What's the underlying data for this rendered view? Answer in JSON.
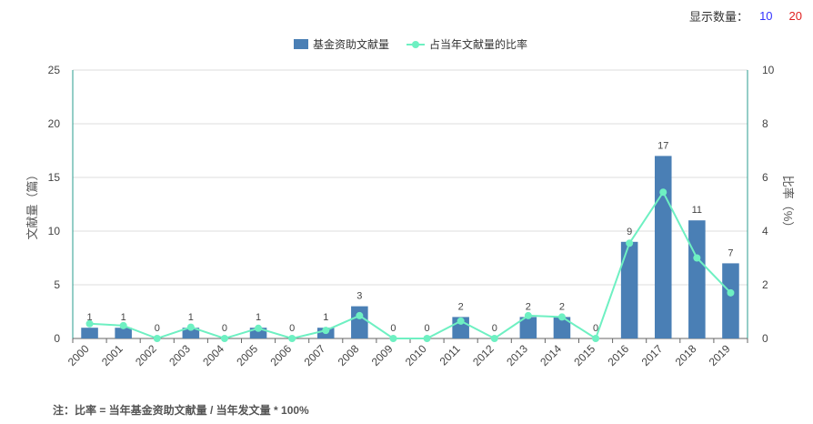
{
  "display_count": {
    "label": "显示数量：",
    "options": [
      {
        "label": "10",
        "color": "#3333ff"
      },
      {
        "label": "20",
        "color": "#e02020"
      }
    ]
  },
  "note": "注：比率 = 当年基金资助文献量 / 当年发文量 * 100%",
  "chart_data": {
    "type": "bar+line",
    "categories": [
      "2000",
      "2001",
      "2002",
      "2003",
      "2004",
      "2005",
      "2006",
      "2007",
      "2008",
      "2009",
      "2010",
      "2011",
      "2012",
      "2013",
      "2014",
      "2015",
      "2016",
      "2017",
      "2018",
      "2019"
    ],
    "series": [
      {
        "name": "基金资助文献量",
        "type": "bar",
        "axis": "left",
        "color": "#4a7fb5",
        "values": [
          1,
          1,
          0,
          1,
          0,
          1,
          0,
          1,
          3,
          0,
          0,
          2,
          0,
          2,
          2,
          0,
          9,
          17,
          11,
          7
        ]
      },
      {
        "name": "占当年文献量的比率",
        "type": "line",
        "axis": "right",
        "color": "#6ef0c2",
        "values": [
          0.55,
          0.48,
          0.0,
          0.42,
          0.0,
          0.38,
          0.0,
          0.3,
          0.85,
          0.0,
          0.0,
          0.65,
          0.0,
          0.85,
          0.8,
          0.0,
          3.55,
          5.45,
          3.0,
          1.7
        ]
      }
    ],
    "ylabel": "文献量（篇）",
    "y2label": "比率（%）",
    "ylim": [
      0,
      25
    ],
    "yticks": [
      0,
      5,
      10,
      15,
      20,
      25
    ],
    "y2lim": [
      0,
      10
    ],
    "y2ticks": [
      0,
      2,
      4,
      6,
      8,
      10
    ],
    "grid": true,
    "legend": "top-center",
    "data_labels": true
  }
}
